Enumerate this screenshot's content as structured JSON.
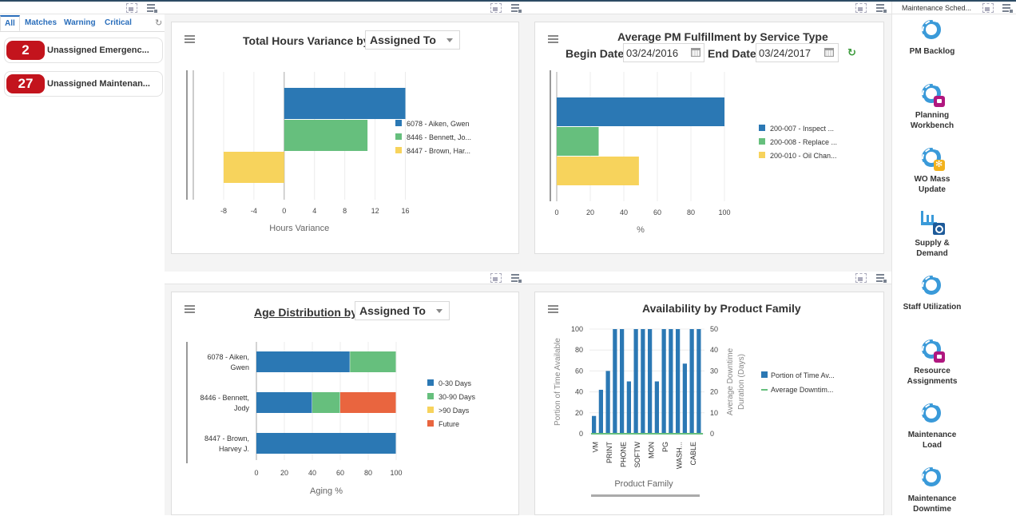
{
  "left_panel": {
    "tabs": [
      {
        "label": "All",
        "active": true
      },
      {
        "label": "Matches",
        "active": false
      },
      {
        "label": "Warning",
        "active": false
      },
      {
        "label": "Critical",
        "active": false
      }
    ],
    "alerts": [
      {
        "count": "2",
        "label": "Unassigned Emergenc..."
      },
      {
        "count": "27",
        "label": "Unassigned Maintenan..."
      }
    ],
    "badge_color": "#c3141d"
  },
  "cards": {
    "hours_variance": {
      "title": "Total Hours Variance by",
      "selector_value": "Assigned To"
    },
    "pm_fulfillment": {
      "title": "Average PM Fulfillment by Service Type",
      "begin_label": "Begin Date",
      "begin_value": "03/24/2016",
      "end_label": "End Date",
      "end_value": "03/24/2017"
    },
    "age_distribution": {
      "title": "Age Distribution by",
      "selector_value": "Assigned To"
    },
    "availability": {
      "title": "Availability by Product Family"
    }
  },
  "chart_data": [
    {
      "id": "hours_variance",
      "type": "bar",
      "orientation": "horizontal",
      "title": "Total Hours Variance by Assigned To",
      "xlabel": "Hours Variance",
      "ylabel": "",
      "xlim": [
        -10,
        17
      ],
      "ticks": [
        -8,
        -4,
        0,
        4,
        8,
        12,
        16
      ],
      "grid": true,
      "legend_position": "right",
      "series": [
        {
          "name": "6078 - Aiken, Gwen",
          "value": 16,
          "color": "#2b78b4"
        },
        {
          "name": "8446 - Bennett, Jo...",
          "value": 11,
          "color": "#66bf7d"
        },
        {
          "name": "8447 - Brown, Har...",
          "value": -8,
          "color": "#f7d35c"
        }
      ]
    },
    {
      "id": "pm_fulfillment",
      "type": "bar",
      "orientation": "horizontal",
      "title": "Average PM Fulfillment by Service Type",
      "xlabel": "%",
      "ylabel": "",
      "xlim": [
        0,
        100
      ],
      "ticks": [
        0,
        20,
        40,
        60,
        80,
        100
      ],
      "grid": true,
      "legend_position": "right",
      "series": [
        {
          "name": "200-007 - Inspect ...",
          "value": 100,
          "color": "#2b78b4"
        },
        {
          "name": "200-008 - Replace ...",
          "value": 25,
          "color": "#66bf7d"
        },
        {
          "name": "200-010 - Oil Chan...",
          "value": 49,
          "color": "#f7d35c"
        }
      ]
    },
    {
      "id": "age_distribution",
      "type": "bar",
      "orientation": "horizontal",
      "stacked": true,
      "title": "Age Distribution by Assigned To",
      "xlabel": "Aging %",
      "ylabel": "",
      "xlim": [
        0,
        100
      ],
      "ticks": [
        0,
        20,
        40,
        60,
        80,
        100
      ],
      "grid": true,
      "legend_position": "right",
      "categories": [
        [
          "6078 - Aiken,",
          "Gwen"
        ],
        [
          "8446 - Bennett,",
          "Jody"
        ],
        [
          "8447 - Brown,",
          "Harvey J."
        ]
      ],
      "series": [
        {
          "name": "0-30 Days",
          "color": "#2b78b4",
          "values": [
            67,
            40,
            100
          ]
        },
        {
          "name": "30-90 Days",
          "color": "#66bf7d",
          "values": [
            33,
            20,
            0
          ]
        },
        {
          "name": ">90 Days",
          "color": "#f7d35c",
          "values": [
            0,
            0,
            0
          ]
        },
        {
          "name": "Future",
          "color": "#e9653f",
          "values": [
            0,
            40,
            0
          ]
        }
      ]
    },
    {
      "id": "availability",
      "type": "bar",
      "title": "Availability by Product Family",
      "xlabel": "Product Family",
      "ylabel": "Portion of Time Available",
      "y2label": [
        "Average Downtime",
        "Duration (Days)"
      ],
      "ylim": [
        0,
        100
      ],
      "y2lim": [
        0,
        50
      ],
      "yticks": [
        0,
        20,
        40,
        60,
        80,
        100
      ],
      "y2ticks": [
        0,
        10,
        20,
        30,
        40,
        50
      ],
      "grid": true,
      "legend_position": "right",
      "tick_labels": [
        "VM",
        "PRINT",
        "PHONE",
        "SOFTW",
        "MON",
        "PG",
        "WASH...",
        "CABLE"
      ],
      "series": [
        {
          "name": "Portion of Time Av...",
          "type": "bar",
          "color": "#2b78b4",
          "values": [
            17,
            42,
            60,
            100,
            100,
            50,
            100,
            100,
            100,
            50,
            100,
            100,
            100,
            67,
            100,
            100
          ]
        },
        {
          "name": "Average Downtim...",
          "type": "line",
          "color": "#66bf7d",
          "values": [
            0,
            0,
            0,
            0,
            0,
            0,
            0,
            0,
            0,
            0,
            0,
            0,
            0,
            0,
            0,
            0
          ]
        }
      ]
    }
  ],
  "right_panel": {
    "title": "Maintenance Sched...",
    "launchers": [
      {
        "label": [
          "PM Backlog"
        ],
        "icon": "cycle-icon"
      },
      {
        "label": [
          "Planning",
          "Workbench"
        ],
        "icon": "cycle-briefcase-icon"
      },
      {
        "label": [
          "WO Mass",
          "Update"
        ],
        "icon": "cycle-gear-icon"
      },
      {
        "label": [
          "Supply &",
          "Demand"
        ],
        "icon": "factory-search-icon"
      },
      {
        "label": [
          "Staff Utilization"
        ],
        "icon": "cycle-icon"
      },
      {
        "label": [
          "Resource",
          "Assignments"
        ],
        "icon": "cycle-briefcase-icon"
      },
      {
        "label": [
          "Maintenance",
          "Load"
        ],
        "icon": "cycle-icon"
      },
      {
        "label": [
          "Maintenance",
          "Downtime"
        ],
        "icon": "cycle-icon"
      }
    ]
  }
}
